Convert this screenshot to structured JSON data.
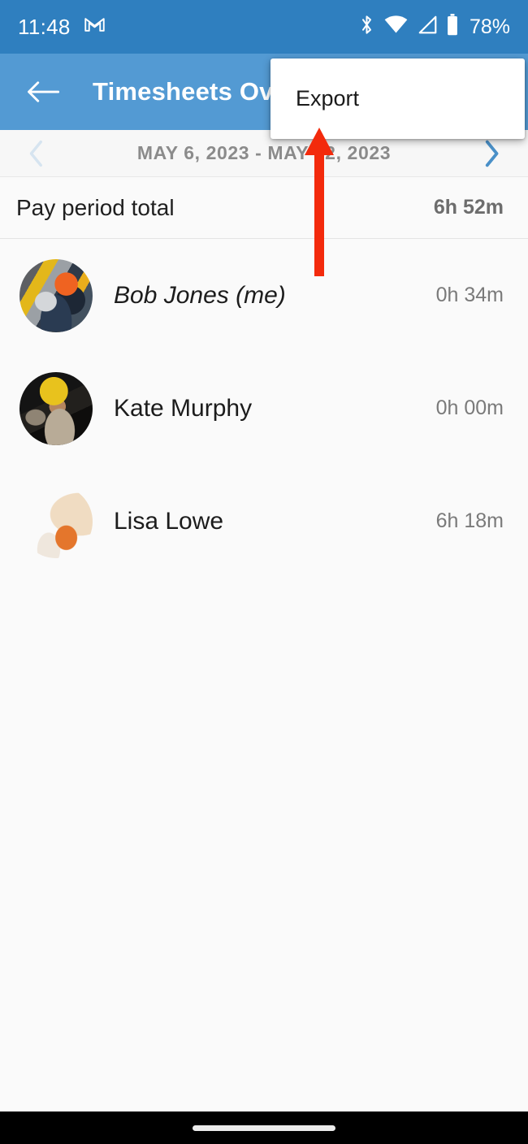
{
  "status_bar": {
    "time": "11:48",
    "icons": [
      "gmail-icon",
      "bluetooth-icon",
      "wifi-icon",
      "cellular-signal-icon",
      "battery-icon"
    ],
    "battery_percent": "78%"
  },
  "app_bar": {
    "back_label": "Back",
    "title": "Timesheets Overview",
    "background_color": "#539ad3"
  },
  "overflow_menu": {
    "visible": true,
    "items": [
      {
        "label": "Export"
      }
    ]
  },
  "date_range": {
    "prev_label": "Previous pay period",
    "label": "MAY 6, 2023 - MAY 12, 2023",
    "next_label": "Next pay period",
    "prev_enabled_color": "#d6e4f0",
    "next_enabled_color": "#4a90c8"
  },
  "summary": {
    "label": "Pay period total",
    "value": "6h 52m"
  },
  "members": [
    {
      "name": "Bob Jones (me)",
      "hours": "0h 34m",
      "is_current_user": true,
      "avatar": "avatar-bob-jones"
    },
    {
      "name": "Kate Murphy",
      "hours": "0h 00m",
      "is_current_user": false,
      "avatar": "avatar-kate-murphy"
    },
    {
      "name": "Lisa Lowe",
      "hours": "6h 18m",
      "is_current_user": false,
      "avatar": "avatar-lisa-lowe"
    }
  ],
  "annotation": {
    "type": "arrow",
    "color": "#f32a0c",
    "points_to": "Export"
  },
  "nav_bar": {
    "gesture_pill": "home-gesture-pill"
  }
}
